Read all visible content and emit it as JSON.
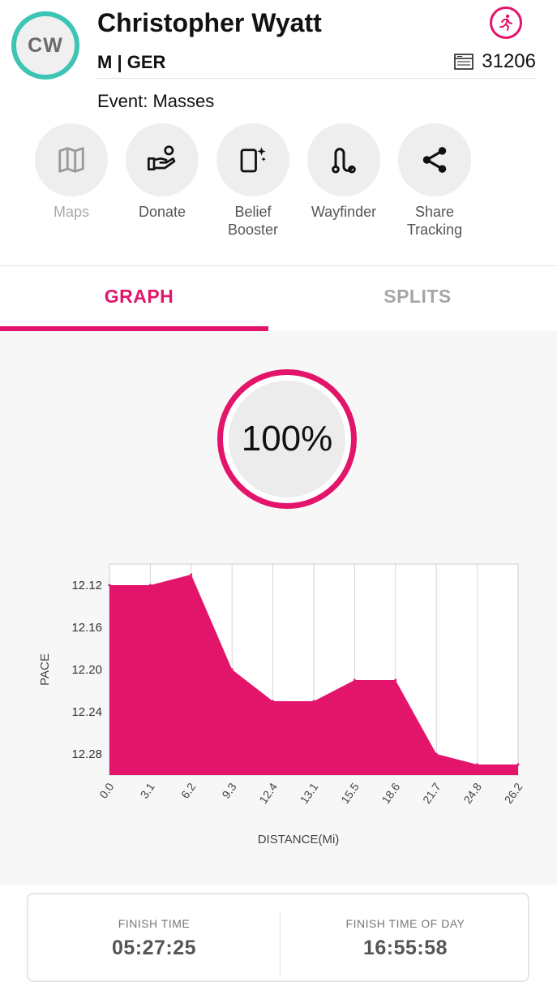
{
  "header": {
    "initials": "CW",
    "name": "Christopher Wyatt",
    "meta": "M | GER",
    "bib_number": "31206",
    "event": "Event: Masses",
    "accent_color": "#e3156b",
    "avatar_ring_color": "#3cc4b4"
  },
  "actions": [
    {
      "label": "Maps",
      "icon": "map-icon",
      "enabled": false
    },
    {
      "label": "Donate",
      "icon": "donate-hand-icon",
      "enabled": true
    },
    {
      "label": "Belief\nBooster",
      "icon": "sparkle-phone-icon",
      "enabled": true
    },
    {
      "label": "Wayfinder",
      "icon": "route-icon",
      "enabled": true
    },
    {
      "label": "Share\nTracking",
      "icon": "share-icon",
      "enabled": true
    }
  ],
  "tabs": [
    {
      "label": "GRAPH",
      "active": true
    },
    {
      "label": "SPLITS",
      "active": false
    }
  ],
  "progress": {
    "label": "100%",
    "value": 1.0
  },
  "chart_data": {
    "type": "area",
    "x": [
      "0.0",
      "3.1",
      "6.2",
      "9.3",
      "12.4",
      "13.1",
      "15.5",
      "18.6",
      "21.7",
      "24.8",
      "26.2"
    ],
    "series": [
      {
        "values": [
          12.12,
          12.12,
          12.11,
          12.2,
          12.23,
          12.23,
          12.21,
          12.21,
          12.28,
          12.29,
          12.29
        ]
      }
    ],
    "y_ticks": [
      "12.12",
      "12.16",
      "12.20",
      "12.24",
      "12.28"
    ],
    "ylim": [
      12.3,
      12.1
    ],
    "ylabel": "PACE",
    "xlabel": "DISTANCE(Mi)",
    "color": "#e3156b",
    "grid": true
  },
  "finish": {
    "time_label": "FINISH TIME",
    "time_value": "05:27:25",
    "tod_label": "FINISH TIME OF DAY",
    "tod_value": "16:55:58"
  }
}
